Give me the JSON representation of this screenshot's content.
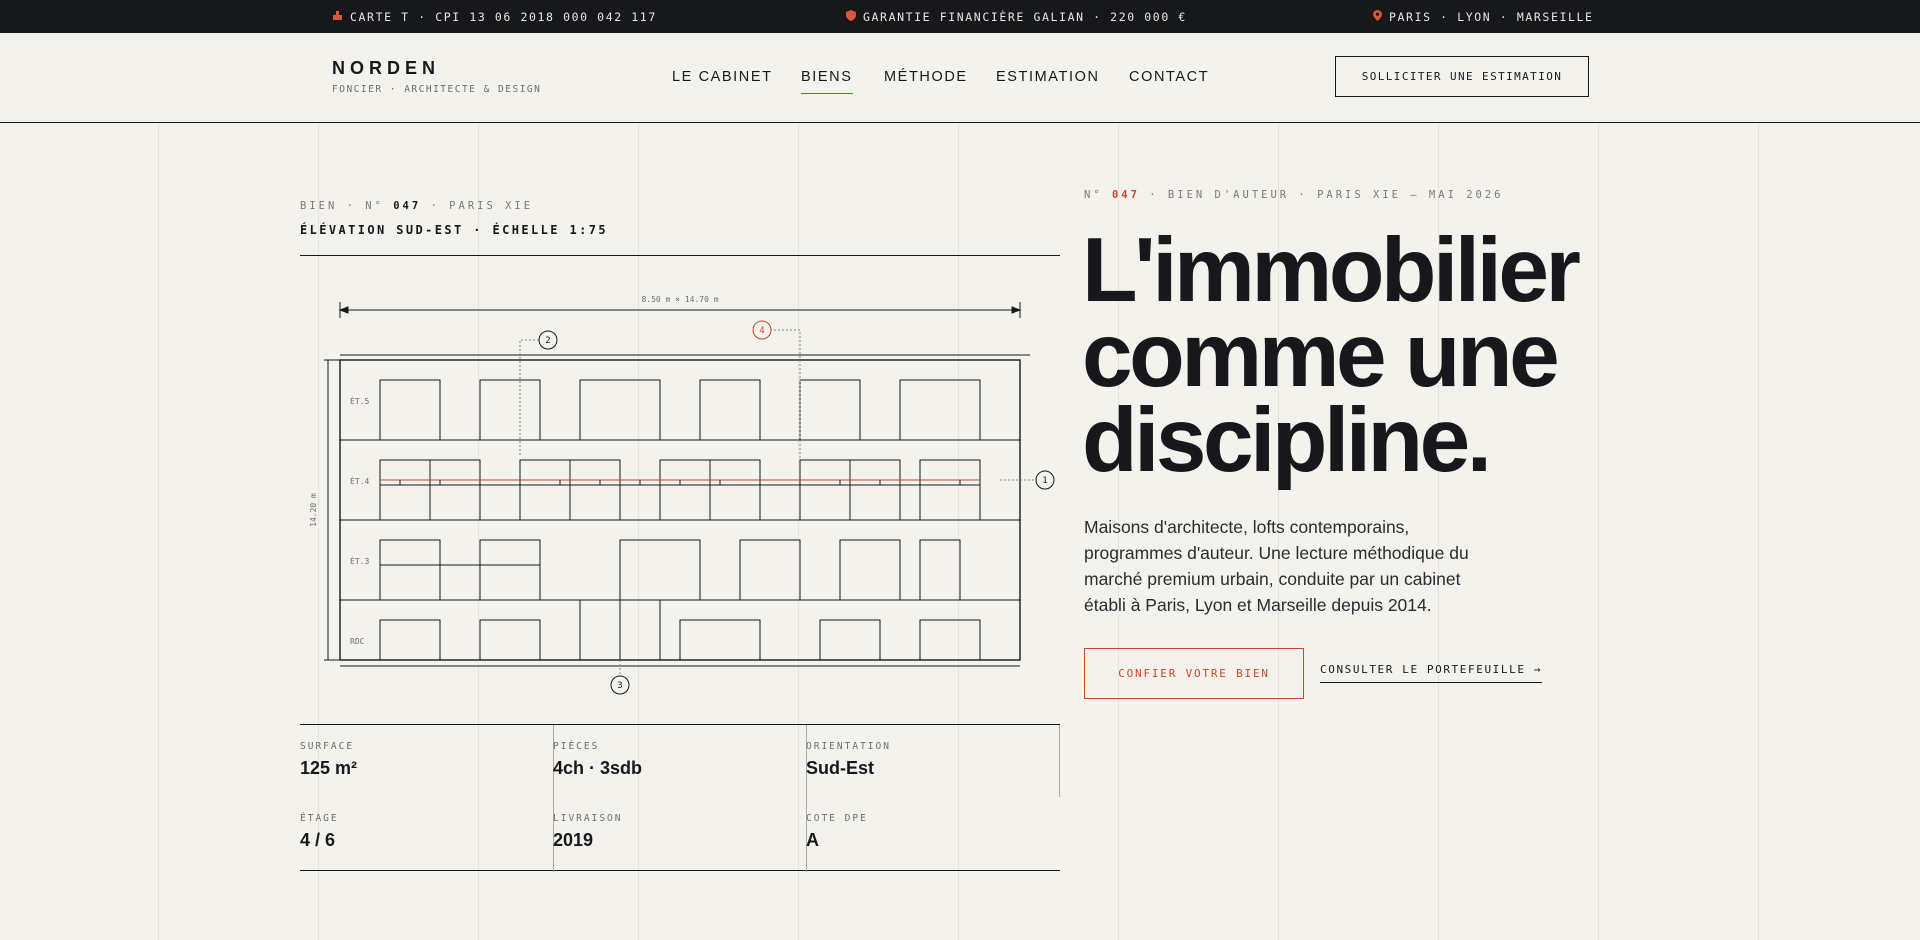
{
  "topbar": {
    "card": "CARTE T · CPI 13 06 2018 000 042 117",
    "guarantee": "GARANTIE FINANCIÈRE GALIAN · 220 000 €",
    "cities": "PARIS · LYON · MARSEILLE",
    "icons": [
      "badge-icon",
      "shield-icon",
      "map-pin-icon"
    ],
    "accent_color": "#d9573a"
  },
  "header": {
    "brand_name": "NORDEN",
    "brand_sub": "FONCIER · ARCHITECTE & DESIGN",
    "nav": [
      {
        "label": "LE CABINET",
        "active": false
      },
      {
        "label": "BIENS",
        "active": true
      },
      {
        "label": "MÉTHODE",
        "active": false
      },
      {
        "label": "ESTIMATION",
        "active": false
      },
      {
        "label": "CONTACT",
        "active": false
      }
    ],
    "cta": "SOLLICITER UNE ESTIMATION"
  },
  "plan": {
    "ref_prefix": "BIEN · N°",
    "ref_number": "047",
    "ref_suffix": "· PARIS XIE",
    "subtitle": "ÉLÉVATION SUD-EST · ÉCHELLE 1:75",
    "dimension_width": "8.50 m × 14.70 m",
    "dimension_height": "14.20 m",
    "floors": [
      "ÉT.5",
      "ÉT.4",
      "ÉT.3",
      "RDC"
    ],
    "markers": [
      "1",
      "2",
      "3",
      "4"
    ],
    "highlight_marker": "4",
    "accent_color": "#c8492c"
  },
  "specs": [
    {
      "label": "SURFACE",
      "value": "125 m²"
    },
    {
      "label": "PIÈCES",
      "value": "4ch · 3sdb"
    },
    {
      "label": "ORIENTATION",
      "value": "Sud-Est"
    },
    {
      "label": "ÉTAGE",
      "value": "4 / 6"
    },
    {
      "label": "LIVRAISON",
      "value": "2019"
    },
    {
      "label": "COTE DPE",
      "value": "A"
    }
  ],
  "hero": {
    "kicker_prefix": "N°",
    "kicker_number": "047",
    "kicker_rest": "· BIEN D'AUTEUR · PARIS XIE — MAI 2026",
    "title_lines": [
      "L'immobilier",
      "comme une",
      "discipline."
    ],
    "lead": "Maisons d'architecte, lofts contemporains, programmes d'auteur. Une lecture méthodique du marché premium urbain, conduite par un cabinet établi à Paris, Lyon et Marseille depuis 2014.",
    "primary_cta": "CONFIER VOTRE BIEN",
    "secondary_cta": "CONSULTER LE PORTEFEUILLE →"
  }
}
